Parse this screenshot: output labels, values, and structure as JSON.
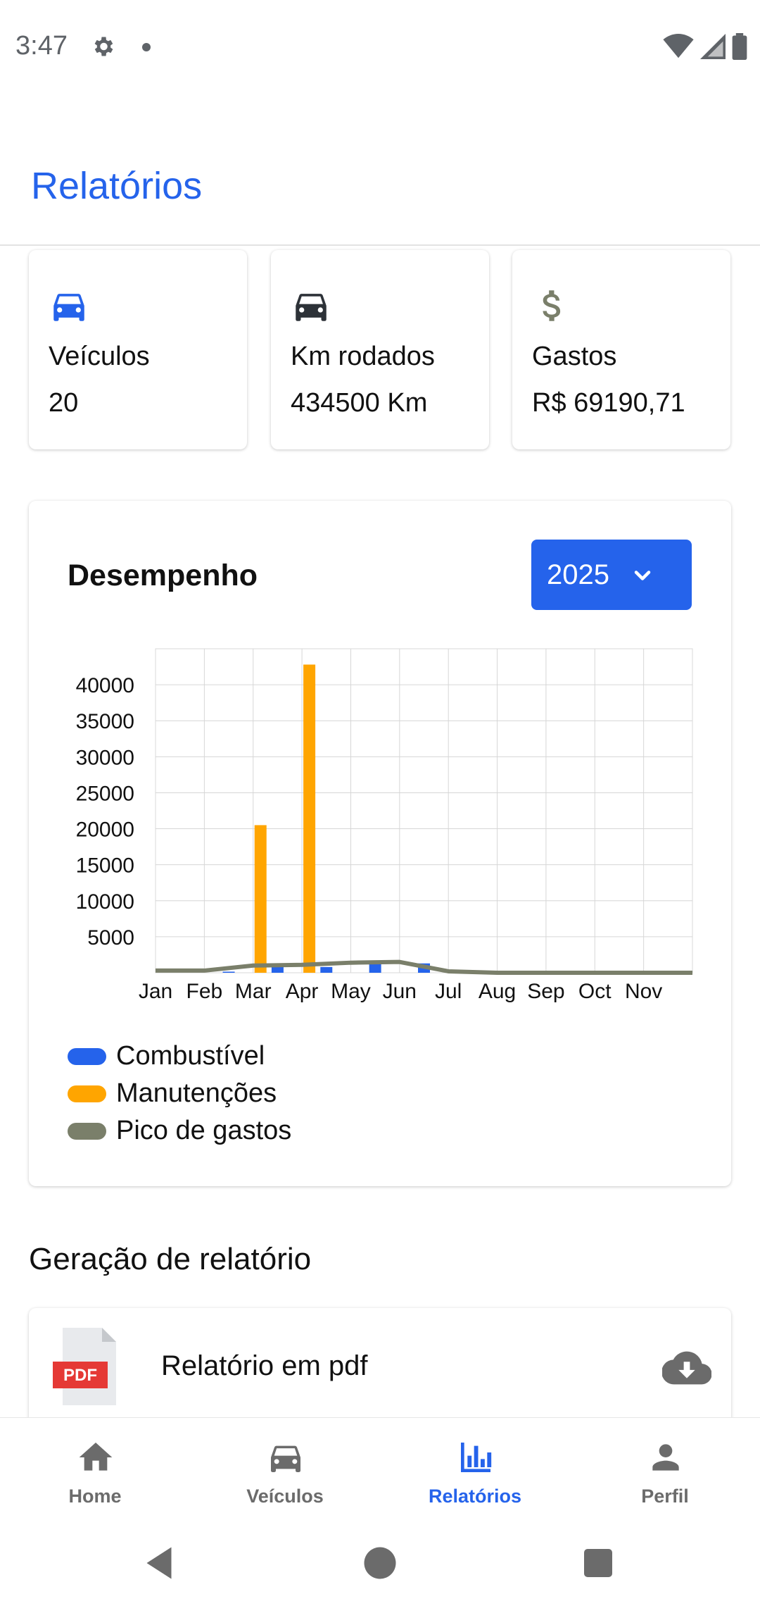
{
  "status_bar": {
    "time": "3:47",
    "icons": [
      "gear-icon",
      "dot-icon",
      "wifi-icon",
      "signal-icon",
      "battery-icon"
    ]
  },
  "app_bar": {
    "title": "Relatórios"
  },
  "summary_cards": [
    {
      "icon": "car-icon",
      "icon_color": "#2563eb",
      "label": "Veículos",
      "value": "20"
    },
    {
      "icon": "car-icon",
      "icon_color": "#2d3238",
      "label": "Km rodados",
      "value": "434500 Km"
    },
    {
      "icon": "dollar-icon",
      "icon_color": "#7a7f6a",
      "label": "Gastos",
      "value": "R$ 69190,71"
    }
  ],
  "performance": {
    "title": "Desempenho",
    "year_select": {
      "selected": "2025"
    }
  },
  "chart_data": {
    "type": "bar",
    "categories": [
      "Jan",
      "Feb",
      "Mar",
      "Apr",
      "May",
      "Jun",
      "Jul",
      "Aug",
      "Sep",
      "Oct",
      "Nov"
    ],
    "y_ticks": [
      "5000",
      "10000",
      "15000",
      "20000",
      "25000",
      "30000",
      "35000",
      "40000"
    ],
    "ylim": [
      0,
      45000
    ],
    "grid": true,
    "legend_position": "bottom-left",
    "series": [
      {
        "name": "Combustível",
        "type": "bar",
        "color": "#2563eb",
        "values": [
          0,
          150,
          900,
          800,
          1200,
          1300,
          150,
          0,
          0,
          0,
          0
        ]
      },
      {
        "name": "Manutenções",
        "type": "bar",
        "color": "#ffa500",
        "values": [
          0,
          0,
          20500,
          42800,
          0,
          0,
          0,
          0,
          0,
          0,
          0
        ]
      },
      {
        "name": "Pico de gastos",
        "type": "line",
        "color": "#7a7f6a",
        "values": [
          300,
          300,
          1000,
          1100,
          1400,
          1500,
          200,
          0,
          0,
          0,
          0
        ]
      }
    ]
  },
  "report_section": {
    "title": "Geração de relatório",
    "pdf_item": {
      "label": "Relatório em pdf",
      "badge": "PDF"
    }
  },
  "bottom_nav": {
    "active": "Relatórios",
    "items": [
      {
        "label": "Home",
        "icon": "home-icon"
      },
      {
        "label": "Veículos",
        "icon": "car-icon"
      },
      {
        "label": "Relatórios",
        "icon": "bar-chart-icon"
      },
      {
        "label": "Perfil",
        "icon": "person-icon"
      }
    ]
  },
  "system_nav": [
    "back-icon",
    "home-circle-icon",
    "recents-icon"
  ]
}
